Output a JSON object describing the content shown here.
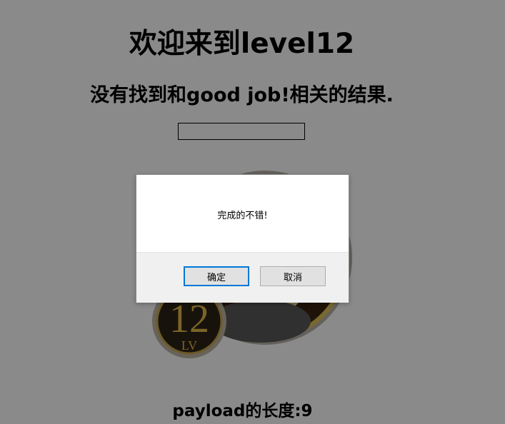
{
  "page": {
    "title": "欢迎来到level12",
    "result_text": "没有找到和good job!相关的结果.",
    "search": {
      "value": ""
    },
    "badge": {
      "number": "12",
      "suffix": "LV"
    },
    "payload_text": "payload的长度:9"
  },
  "dialog": {
    "message": "完成的不错!",
    "ok_label": "确定",
    "cancel_label": "取消"
  },
  "colors": {
    "overlay": "#8a8a8a",
    "accent": "#0078d7",
    "dialog_footer": "#f0f0f0"
  }
}
